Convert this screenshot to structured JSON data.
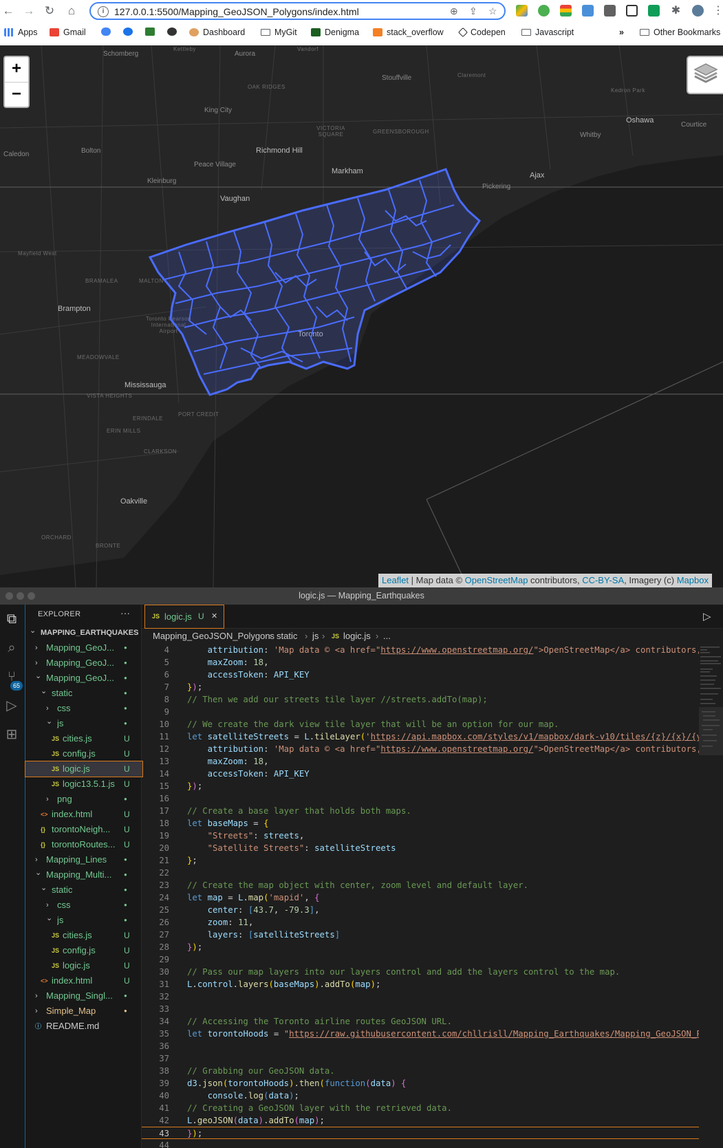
{
  "browser": {
    "url": "127.0.0.1:5500/Mapping_GeoJSON_Polygons/index.html",
    "bookmarks": [
      {
        "label": "Apps",
        "icon": "apps-grid-icon"
      },
      {
        "label": "Gmail",
        "icon": "gmail-icon"
      },
      {
        "label": "",
        "icon": "cloud-icon"
      },
      {
        "label": "",
        "icon": "c-icon"
      },
      {
        "label": "",
        "icon": "w-icon"
      },
      {
        "label": "",
        "icon": "circle-icon"
      },
      {
        "label": "Dashboard",
        "icon": "dashboard-icon"
      },
      {
        "label": "MyGit",
        "icon": "folder-icon"
      },
      {
        "label": "Denigma",
        "icon": "d-icon"
      },
      {
        "label": "stack_overflow",
        "icon": "stack-overflow-icon"
      },
      {
        "label": "Codepen",
        "icon": "codepen-icon"
      },
      {
        "label": "Javascript",
        "icon": "folder-icon"
      }
    ],
    "more_bookmarks": "»",
    "other_bookmarks": "Other Bookmarks"
  },
  "map": {
    "labels": [
      {
        "text": "Schomberg",
        "cls": "",
        "k": "a"
      },
      {
        "text": "Kettleby",
        "cls": "faint",
        "k": "b"
      },
      {
        "text": "Aurora",
        "cls": "",
        "k": "c"
      },
      {
        "text": "Vandorf",
        "cls": "faint",
        "k": "d"
      },
      {
        "text": "Stouffville",
        "cls": "",
        "k": "e"
      },
      {
        "text": "Claremont",
        "cls": "faint",
        "k": "f"
      },
      {
        "text": "OAK RIDGES",
        "cls": "faint",
        "k": "g"
      },
      {
        "text": "Kedron Park",
        "cls": "faint",
        "k": "h"
      },
      {
        "text": "King City",
        "cls": "",
        "k": "i"
      },
      {
        "text": "Oshawa",
        "cls": "city",
        "k": "j"
      },
      {
        "text": "Courtice",
        "cls": "",
        "k": "k"
      },
      {
        "text": "VICTORIA SQUARE",
        "cls": "faint",
        "k": "l"
      },
      {
        "text": "GREENSBOROUGH",
        "cls": "faint",
        "k": "m"
      },
      {
        "text": "Whitby",
        "cls": "",
        "k": "n"
      },
      {
        "text": "Caledon",
        "cls": "",
        "k": "o"
      },
      {
        "text": "Bolton",
        "cls": "",
        "k": "p"
      },
      {
        "text": "Richmond Hill",
        "cls": "city",
        "k": "q"
      },
      {
        "text": "Peace Village",
        "cls": "",
        "k": "r"
      },
      {
        "text": "Markham",
        "cls": "city",
        "k": "s"
      },
      {
        "text": "Ajax",
        "cls": "city",
        "k": "t"
      },
      {
        "text": "Kleinburg",
        "cls": "",
        "k": "u"
      },
      {
        "text": "Pickering",
        "cls": "",
        "k": "v"
      },
      {
        "text": "Vaughan",
        "cls": "city",
        "k": "w"
      },
      {
        "text": "Mayfield West",
        "cls": "faint",
        "k": "x"
      },
      {
        "text": "BRAMALEA",
        "cls": "faint",
        "k": "y"
      },
      {
        "text": "MALTON",
        "cls": "faint",
        "k": "z"
      },
      {
        "text": "Brampton",
        "cls": "city",
        "k": "aa"
      },
      {
        "text": "Toronto Pearson International Airport",
        "cls": "faint",
        "k": "ab"
      },
      {
        "text": "MEADOWVALE",
        "cls": "faint",
        "k": "ac"
      },
      {
        "text": "Mississauga",
        "cls": "city",
        "k": "ad"
      },
      {
        "text": "VISTA HEIGHTS",
        "cls": "faint",
        "k": "ae"
      },
      {
        "text": "ERINDALE",
        "cls": "faint",
        "k": "af"
      },
      {
        "text": "PORT CREDIT",
        "cls": "faint",
        "k": "ag"
      },
      {
        "text": "ERIN MILLS",
        "cls": "faint",
        "k": "ah"
      },
      {
        "text": "CLARKSON",
        "cls": "faint",
        "k": "ai"
      },
      {
        "text": "Oakville",
        "cls": "city",
        "k": "aj"
      },
      {
        "text": "ORCHARD",
        "cls": "faint",
        "k": "ak"
      },
      {
        "text": "BRONTE",
        "cls": "faint",
        "k": "al"
      },
      {
        "text": "Toronto",
        "cls": "city",
        "k": "am"
      }
    ],
    "zoom_in": "+",
    "zoom_out": "−",
    "attribution": {
      "leaflet": "Leaflet",
      "text1": " | Map data © ",
      "osm": "OpenStreetMap",
      "text2": " contributors, ",
      "license": "CC-BY-SA",
      "text3": ", Imagery (c) ",
      "mapbox": "Mapbox"
    },
    "polygon_color": "#4a6cff"
  },
  "vscode": {
    "window_title": "logic.js — Mapping_Earthquakes",
    "explorer_title": "EXPLORER",
    "explorer_more": "···",
    "tree": [
      {
        "label": "MAPPING_EARTHQUAKES",
        "depth": 0,
        "kind": "root",
        "open": true,
        "status": "",
        "color": "#cccccc"
      },
      {
        "label": "Mapping_GeoJ...",
        "depth": 1,
        "kind": "folder",
        "open": false,
        "status": "●",
        "color": "#73c991"
      },
      {
        "label": "Mapping_GeoJ...",
        "depth": 1,
        "kind": "folder",
        "open": false,
        "status": "●",
        "color": "#73c991"
      },
      {
        "label": "Mapping_GeoJ...",
        "depth": 1,
        "kind": "folder",
        "open": true,
        "status": "●",
        "color": "#73c991"
      },
      {
        "label": "static",
        "depth": 2,
        "kind": "folder",
        "open": true,
        "status": "●",
        "color": "#73c991"
      },
      {
        "label": "css",
        "depth": 3,
        "kind": "folder",
        "open": false,
        "status": "●",
        "color": "#73c991"
      },
      {
        "label": "js",
        "depth": 3,
        "kind": "folder",
        "open": true,
        "status": "●",
        "color": "#73c991"
      },
      {
        "label": "cities.js",
        "depth": 4,
        "kind": "js",
        "status": "U",
        "color": "#73c991"
      },
      {
        "label": "config.js",
        "depth": 4,
        "kind": "js",
        "status": "U",
        "color": "#73c991"
      },
      {
        "label": "logic.js",
        "depth": 4,
        "kind": "js",
        "status": "U",
        "color": "#73c991",
        "active": true
      },
      {
        "label": "logic13.5.1.js",
        "depth": 4,
        "kind": "js",
        "status": "U",
        "color": "#73c991"
      },
      {
        "label": "png",
        "depth": 3,
        "kind": "folder",
        "open": false,
        "status": "●",
        "color": "#73c991"
      },
      {
        "label": "index.html",
        "depth": 2,
        "kind": "html",
        "status": "U",
        "color": "#73c991"
      },
      {
        "label": "torontoNeigh...",
        "depth": 2,
        "kind": "json",
        "status": "U",
        "color": "#73c991"
      },
      {
        "label": "torontoRoutes...",
        "depth": 2,
        "kind": "json",
        "status": "U",
        "color": "#73c991"
      },
      {
        "label": "Mapping_Lines",
        "depth": 1,
        "kind": "folder",
        "open": false,
        "status": "●",
        "color": "#73c991"
      },
      {
        "label": "Mapping_Multi...",
        "depth": 1,
        "kind": "folder",
        "open": true,
        "status": "●",
        "color": "#73c991"
      },
      {
        "label": "static",
        "depth": 2,
        "kind": "folder",
        "open": true,
        "status": "●",
        "color": "#73c991"
      },
      {
        "label": "css",
        "depth": 3,
        "kind": "folder",
        "open": false,
        "status": "●",
        "color": "#73c991"
      },
      {
        "label": "js",
        "depth": 3,
        "kind": "folder",
        "open": true,
        "status": "●",
        "color": "#73c991"
      },
      {
        "label": "cities.js",
        "depth": 4,
        "kind": "js",
        "status": "U",
        "color": "#73c991"
      },
      {
        "label": "config.js",
        "depth": 4,
        "kind": "js",
        "status": "U",
        "color": "#73c991"
      },
      {
        "label": "logic.js",
        "depth": 4,
        "kind": "js",
        "status": "U",
        "color": "#73c991"
      },
      {
        "label": "index.html",
        "depth": 2,
        "kind": "html",
        "status": "U",
        "color": "#73c991"
      },
      {
        "label": "Mapping_Singl...",
        "depth": 1,
        "kind": "folder",
        "open": false,
        "status": "●",
        "color": "#73c991"
      },
      {
        "label": "Simple_Map",
        "depth": 1,
        "kind": "folder",
        "open": false,
        "status": "●",
        "color": "#e2c08d"
      },
      {
        "label": "README.md",
        "depth": 1,
        "kind": "md",
        "status": "",
        "color": "#cccccc"
      }
    ],
    "tab": {
      "icon": "JS",
      "label": "logic.js",
      "status": "U",
      "close": "✕"
    },
    "breadcrumb": [
      "Mapping_GeoJSON_Polygons",
      "static",
      "js",
      "logic.js",
      "..."
    ],
    "code_lines": [
      {
        "n": "4",
        "html": "    <span class='v'>attribution</span>: <span class='s'>'Map data © &lt;a href=\"</span><span class='u'>https://www.openstreetmap.org/</span><span class='s'>\"&gt;OpenStreetMap&lt;/a&gt; contributors,</span>"
      },
      {
        "n": "5",
        "html": "    <span class='v'>maxZoom</span>: <span class='n'>18</span>,"
      },
      {
        "n": "6",
        "html": "    <span class='v'>accessToken</span>: <span class='v'>API_KEY</span>"
      },
      {
        "n": "7",
        "html": "<span class='y'>}</span><span class='p'>)</span>;"
      },
      {
        "n": "8",
        "html": "<span class='c'>// Then we add our streets tile layer //streets.addTo(map);</span>"
      },
      {
        "n": "9",
        "html": ""
      },
      {
        "n": "10",
        "html": "<span class='c'>// We create the dark view tile layer that will be an option for our map.</span>"
      },
      {
        "n": "11",
        "html": "<span class='k'>let</span> <span class='v'>satelliteStreets</span> = <span class='v'>L</span>.<span class='f'>tileLayer</span><span class='y'>(</span><span class='s'>'</span><span class='u'>https://api.mapbox.com/styles/v1/mapbox/dark-v10/tiles/{z}/{x}/{y}</span>"
      },
      {
        "n": "12",
        "html": "    <span class='v'>attribution</span>: <span class='s'>'Map data © &lt;a href=\"</span><span class='u'>https://www.openstreetmap.org/</span><span class='s'>\"&gt;OpenStreetMap&lt;/a&gt; contributors,</span>"
      },
      {
        "n": "13",
        "html": "    <span class='v'>maxZoom</span>: <span class='n'>18</span>,"
      },
      {
        "n": "14",
        "html": "    <span class='v'>accessToken</span>: <span class='v'>API_KEY</span>"
      },
      {
        "n": "15",
        "html": "<span class='y'>}</span><span class='p'>)</span>;"
      },
      {
        "n": "16",
        "html": ""
      },
      {
        "n": "17",
        "html": "<span class='c'>// Create a base layer that holds both maps.</span>"
      },
      {
        "n": "18",
        "html": "<span class='k'>let</span> <span class='v'>baseMaps</span> = <span class='y'>{</span>"
      },
      {
        "n": "19",
        "html": "    <span class='s'>\"Streets\"</span>: <span class='v'>streets</span>,"
      },
      {
        "n": "20",
        "html": "    <span class='s'>\"Satellite Streets\"</span>: <span class='v'>satelliteStreets</span>"
      },
      {
        "n": "21",
        "html": "<span class='y'>}</span>;"
      },
      {
        "n": "22",
        "html": ""
      },
      {
        "n": "23",
        "html": "<span class='c'>// Create the map object with center, zoom level and default layer.</span>"
      },
      {
        "n": "24",
        "html": "<span class='k'>let</span> <span class='v'>map</span> = <span class='v'>L</span>.<span class='f'>map</span><span class='y'>(</span><span class='s'>'mapid'</span>, <span class='p'>{</span>"
      },
      {
        "n": "25",
        "html": "    <span class='v'>center</span>: <span class='k'>[</span><span class='n'>43.7</span>, <span class='n'>-79.3</span><span class='k'>]</span>,"
      },
      {
        "n": "26",
        "html": "    <span class='v'>zoom</span>: <span class='n'>11</span>,"
      },
      {
        "n": "27",
        "html": "    <span class='v'>layers</span>: <span class='k'>[</span><span class='v'>satelliteStreets</span><span class='k'>]</span>"
      },
      {
        "n": "28",
        "html": "<span class='p'>}</span><span class='y'>)</span>;"
      },
      {
        "n": "29",
        "html": ""
      },
      {
        "n": "30",
        "html": "<span class='c'>// Pass our map layers into our layers control and add the layers control to the map.</span>"
      },
      {
        "n": "31",
        "html": "<span class='v'>L</span>.<span class='v'>control</span>.<span class='f'>layers</span><span class='y'>(</span><span class='v'>baseMaps</span><span class='y'>)</span>.<span class='f'>addTo</span><span class='y'>(</span><span class='v'>map</span><span class='y'>)</span>;"
      },
      {
        "n": "32",
        "html": ""
      },
      {
        "n": "33",
        "html": ""
      },
      {
        "n": "34",
        "html": "<span class='c'>// Accessing the Toronto airline routes GeoJSON URL.</span>"
      },
      {
        "n": "35",
        "html": "<span class='k'>let</span> <span class='v'>torontoHoods</span> = <span class='s'>\"</span><span class='u'>https://raw.githubusercontent.com/chllrisll/Mapping_Earthquakes/Mapping_GeoJSON_Po</span>"
      },
      {
        "n": "36",
        "html": ""
      },
      {
        "n": "37",
        "html": ""
      },
      {
        "n": "38",
        "html": "<span class='c'>// Grabbing our GeoJSON data.</span>"
      },
      {
        "n": "39",
        "html": "<span class='v'>d3</span>.<span class='f'>json</span><span class='y'>(</span><span class='v'>torontoHoods</span><span class='y'>)</span>.<span class='f'>then</span><span class='y'>(</span><span class='k'>function</span><span class='p'>(</span><span class='v'>data</span><span class='p'>)</span> <span class='p'>{</span>"
      },
      {
        "n": "40",
        "html": "    <span class='v'>console</span>.<span class='f'>log</span><span class='k'>(</span><span class='v'>data</span><span class='k'>)</span>;"
      },
      {
        "n": "41",
        "html": "<span class='c'>// Creating a GeoJSON layer with the retrieved data.</span>"
      },
      {
        "n": "42",
        "html": "<span class='v'>L</span>.<span class='f'>geoJSON</span><span class='p'>(</span><span class='v'>data</span><span class='p'>)</span>.<span class='f'>addTo</span><span class='p'>(</span><span class='v'>map</span><span class='p'>)</span>;"
      },
      {
        "n": "43",
        "html": "<span class='p'>}</span><span class='y'>)</span>;",
        "current": true
      },
      {
        "n": "44",
        "html": ""
      }
    ]
  }
}
